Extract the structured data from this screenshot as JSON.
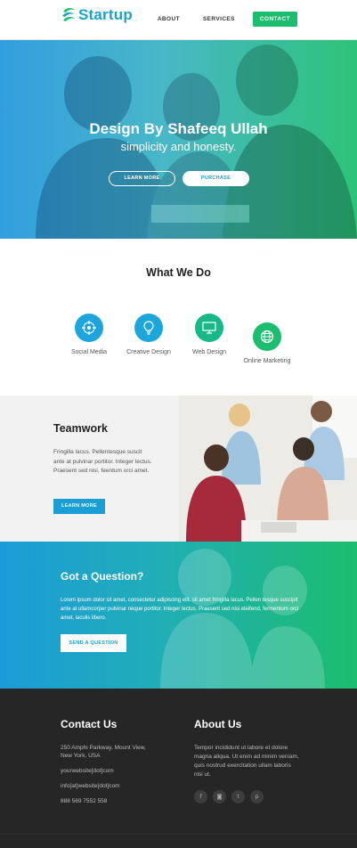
{
  "header": {
    "logo_text": "Startup",
    "nav": [
      {
        "label": "ABOUT"
      },
      {
        "label": "SERVICES"
      },
      {
        "label": "CONTACT"
      }
    ]
  },
  "hero": {
    "title": "Design By Shafeeq Ullah",
    "subtitle": "simplicity and honesty.",
    "learn_more": "LEARN MORE",
    "purchase": "PURCHASE"
  },
  "what_we_do": {
    "title": "What We Do",
    "services": [
      {
        "label": "Social Media",
        "icon": "target-icon",
        "color": "#1ea5e0"
      },
      {
        "label": "Creative Design",
        "icon": "lightbulb-icon",
        "color": "#1da6d9"
      },
      {
        "label": "Web Design",
        "icon": "monitor-icon",
        "color": "#17b98a"
      },
      {
        "label": "Online Marketing",
        "icon": "globe-icon",
        "color": "#1bbd6e"
      }
    ]
  },
  "teamwork": {
    "title": "Teamwork",
    "text": "Fringilla lacus. Pellentesque suscit ante at pulvinar portitor. Integer lectus. Praesent sed nisi, feentum orci amet.",
    "button": "LEARN MORE"
  },
  "question": {
    "title": "Got a Question?",
    "text": "Lorem ipsum dolor sit amet, consectetur adipiscing elit. sit amet fringilla lacus. Pellen tesque suscipit ante at ullamcorper pulvinar neque portitor. Integer lectus. Praesent sed nisi eleifend, fermentum orci amet, iaculis libero.",
    "button": "SEND A QUESTION"
  },
  "footer": {
    "contact_title": "Contact Us",
    "address": "250 Amphi Parkway, Mount View, New York, USA",
    "website": "yourwebsite[dot]com",
    "email": "info[at]website[dot]com",
    "phone": "888 569 7552 558",
    "about_title": "About Us",
    "about_text": "Tempor incididunt ut labore et dolore magna aliqua. Ut enim ad minim veniam, quis nostrud exercitation ullam laboris nisi ut.",
    "socials": [
      {
        "icon": "facebook-icon",
        "glyph": "f"
      },
      {
        "icon": "instagram-icon",
        "glyph": "◙"
      },
      {
        "icon": "twitter-icon",
        "glyph": "t"
      },
      {
        "icon": "pinterest-icon",
        "glyph": "p"
      }
    ]
  },
  "colors": {
    "brand_blue": "#1ba3c9",
    "brand_green": "#1bbd6e",
    "footer_bg": "#262626"
  }
}
